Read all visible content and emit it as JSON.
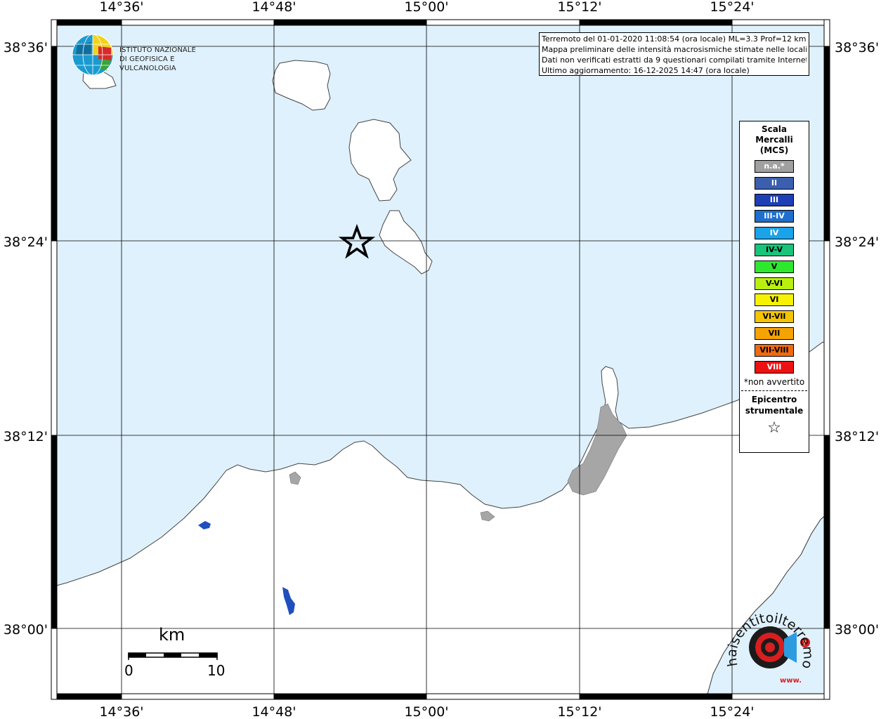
{
  "map": {
    "top_labels": [
      "14°36'",
      "14°48'",
      "15°00'",
      "15°12'",
      "15°24'"
    ],
    "bottom_labels": [
      "14°36'",
      "14°48'",
      "15°00'",
      "15°12'",
      "15°24'"
    ],
    "left_labels": [
      "38°36'",
      "38°24'",
      "38°12'",
      "38°00'"
    ],
    "right_labels": [
      "38°36'",
      "38°24'",
      "38°12'",
      "38°00'"
    ],
    "colors": {
      "sea": "#dff1fd",
      "land": "#ffffff",
      "urban": "#a6a6a6",
      "lakes": "#1f4fbf",
      "grid": "#000000"
    }
  },
  "info": {
    "line1": "Terremoto del 01-01-2020 11:08:54 (ora locale) ML=3.3 Prof=12 km",
    "line2": "Mappa preliminare delle intensità macrosismiche stimate nelle località",
    "line3": "Dati non verificati estratti da 9 questionari compilati tramite Internet.",
    "line4": "Ultimo aggiornamento: 16-12-2025 14:47 (ora locale)"
  },
  "logo": {
    "line1": "ISTITUTO NAZIONALE",
    "line2": "DI GEOFISICA E VULCANOLOGIA"
  },
  "legend": {
    "title_line1": "Scala",
    "title_line2": "Mercalli",
    "title_line3": "(MCS)",
    "items": [
      {
        "label": "n.a.*",
        "color": "#a0a0a0"
      },
      {
        "label": "II",
        "color": "#3b5fae"
      },
      {
        "label": "III",
        "color": "#1d3fb5"
      },
      {
        "label": "III-IV",
        "color": "#1e6fd0"
      },
      {
        "label": "IV",
        "color": "#1aa3e8"
      },
      {
        "label": "IV-V",
        "color": "#18c47a"
      },
      {
        "label": "V",
        "color": "#2ee82e"
      },
      {
        "label": "V-VI",
        "color": "#b9f010"
      },
      {
        "label": "VI",
        "color": "#f7f200"
      },
      {
        "label": "VI-VII",
        "color": "#f5c400"
      },
      {
        "label": "VII",
        "color": "#f5a300"
      },
      {
        "label": "VII-VIII",
        "color": "#f06a10"
      },
      {
        "label": "VIII",
        "color": "#ee1111"
      }
    ],
    "note": "*non avvertito",
    "epicentre_line1": "Epicentro",
    "epicentre_line2": "strumentale",
    "star": "☆"
  },
  "scale": {
    "unit": "km",
    "min": "0",
    "max": "10"
  },
  "site_logo": {
    "text": "haisentitoilterremoto.it",
    "prefix": "www."
  }
}
